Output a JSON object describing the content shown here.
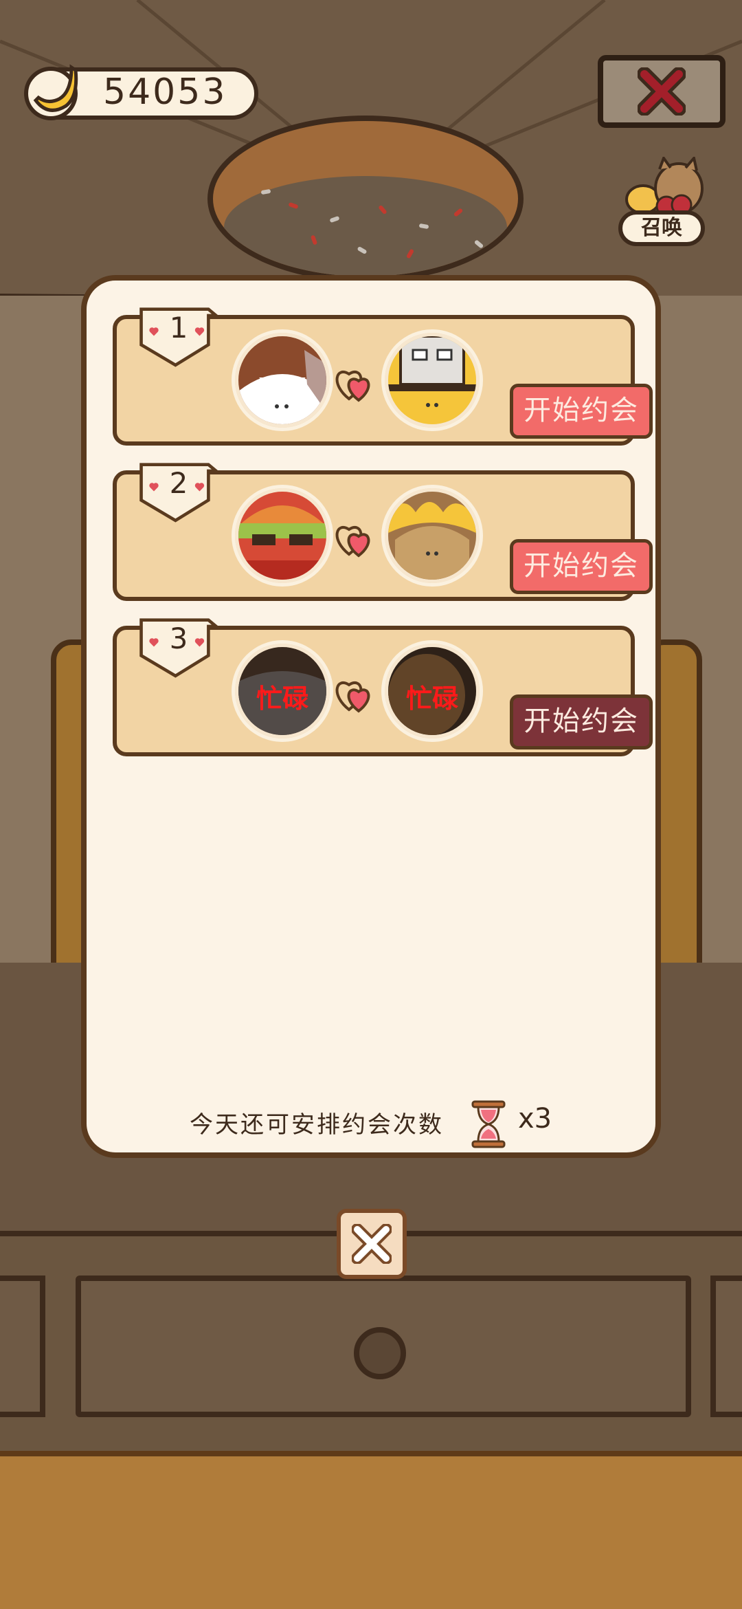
{
  "currency": {
    "value": "54053",
    "icon": "banana-icon"
  },
  "summon": {
    "label": "召唤"
  },
  "dates": [
    {
      "rank": "1",
      "button": "开始约会",
      "status": "active",
      "left_busy": "",
      "right_busy": ""
    },
    {
      "rank": "2",
      "button": "开始约会",
      "status": "active",
      "left_busy": "",
      "right_busy": ""
    },
    {
      "rank": "3",
      "button": "开始约会",
      "status": "disabled",
      "left_busy": "忙碌",
      "right_busy": "忙碌"
    }
  ],
  "footer": {
    "text": "今天还可安排约会次数",
    "count": "x3"
  },
  "colors": {
    "button_active": "#f26b69",
    "button_disabled": "#7d3339",
    "busy_text": "#ff1a1a"
  }
}
